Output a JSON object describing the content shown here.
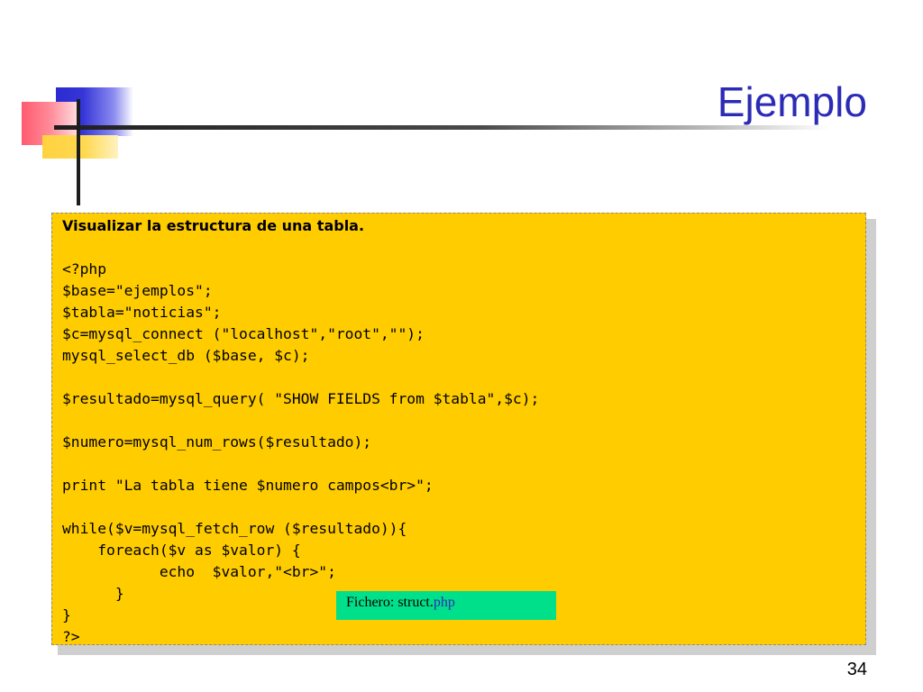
{
  "slide": {
    "title": "Ejemplo",
    "page_number": "34",
    "heading": "Visualizar la estructura de una tabla.",
    "code_lines": [
      "<?php",
      "$base=\"ejemplos\";",
      "$tabla=\"noticias\";",
      "$c=mysql_connect (\"localhost\",\"root\",\"\");",
      "mysql_select_db ($base, $c);",
      "",
      "$resultado=mysql_query( \"SHOW FIELDS from $tabla\",$c);",
      "",
      "$numero=mysql_num_rows($resultado);",
      "",
      "print \"La tabla tiene $numero campos<br>\";",
      "",
      "while($v=mysql_fetch_row ($resultado)){",
      "    foreach($v as $valor) {",
      "           echo  $valor,\"<br>\";",
      "      }",
      "}",
      "?>"
    ],
    "file_label": {
      "prefix": "Fichero: struct.",
      "extension": "php"
    }
  },
  "colors": {
    "title": "#2b2bb5",
    "panel_background": "#ffcc00",
    "file_label_background": "#00e08a",
    "file_extension": "#2b2bb5"
  }
}
